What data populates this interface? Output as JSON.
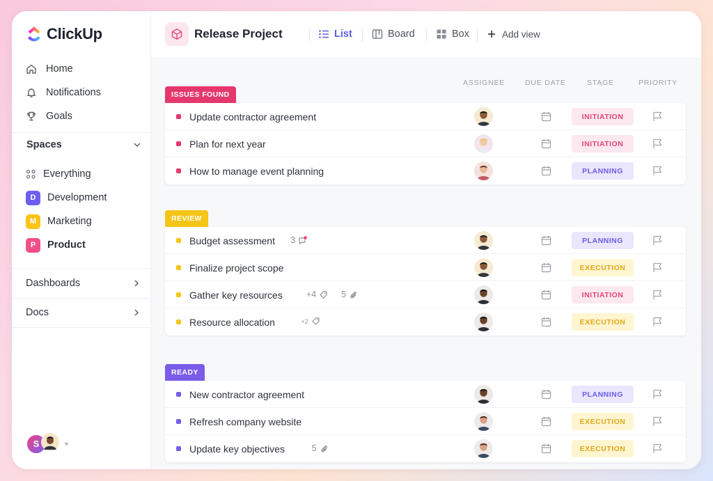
{
  "app": {
    "name": "ClickUp"
  },
  "sidebar": {
    "nav": [
      {
        "label": "Home",
        "icon": "home-icon"
      },
      {
        "label": "Notifications",
        "icon": "bell-icon"
      },
      {
        "label": "Goals",
        "icon": "trophy-icon"
      }
    ],
    "spaces_title": "Spaces",
    "spaces": [
      {
        "label": "Everything",
        "badge": "",
        "color": ""
      },
      {
        "label": "Development",
        "badge": "D",
        "color": "#6d5df0"
      },
      {
        "label": "Marketing",
        "badge": "M",
        "color": "#fcc419"
      },
      {
        "label": "Product",
        "badge": "P",
        "color": "#f24f89"
      }
    ],
    "dashboards": "Dashboards",
    "docs": "Docs",
    "user_initial": "S"
  },
  "header": {
    "project_title": "Release Project",
    "views": [
      "List",
      "Board",
      "Box"
    ],
    "add_view": "Add view"
  },
  "columns": [
    "ASSIGNEE",
    "DUE DATE",
    "STAGE",
    "PRIORITY"
  ],
  "stage_colors": {
    "INITIATION": {
      "bg": "#fde8ef",
      "fg": "#e2457a"
    },
    "PLANNING": {
      "bg": "#e9e6fd",
      "fg": "#6b5ce7"
    },
    "EXECUTION": {
      "bg": "#fff5d1",
      "fg": "#e3a91a"
    }
  },
  "groups": [
    {
      "label": "ISSUES FOUND",
      "color": "#e5386d",
      "tasks": [
        {
          "name": "Update contractor agreement",
          "stage": "INITIATION",
          "extra": ""
        },
        {
          "name": "Plan for next year",
          "stage": "INITIATION",
          "extra": ""
        },
        {
          "name": "How to manage event planning",
          "stage": "PLANNING",
          "extra": ""
        }
      ]
    },
    {
      "label": "REVIEW",
      "color": "#f5c518",
      "tasks": [
        {
          "name": "Budget assessment",
          "stage": "PLANNING",
          "extra": "3"
        },
        {
          "name": "Finalize project scope",
          "stage": "EXECUTION",
          "extra": ""
        },
        {
          "name": "Gather key resources",
          "stage": "INITIATION",
          "extra": "+4",
          "extra2": "5"
        },
        {
          "name": "Resource allocation",
          "stage": "EXECUTION",
          "extra": "+2"
        }
      ]
    },
    {
      "label": "READY",
      "color": "#7a5ce8",
      "tasks": [
        {
          "name": "New contractor agreement",
          "stage": "PLANNING",
          "extra": ""
        },
        {
          "name": "Refresh company website",
          "stage": "EXECUTION",
          "extra": ""
        },
        {
          "name": "Update key objectives",
          "stage": "EXECUTION",
          "extra": "5"
        }
      ]
    }
  ]
}
